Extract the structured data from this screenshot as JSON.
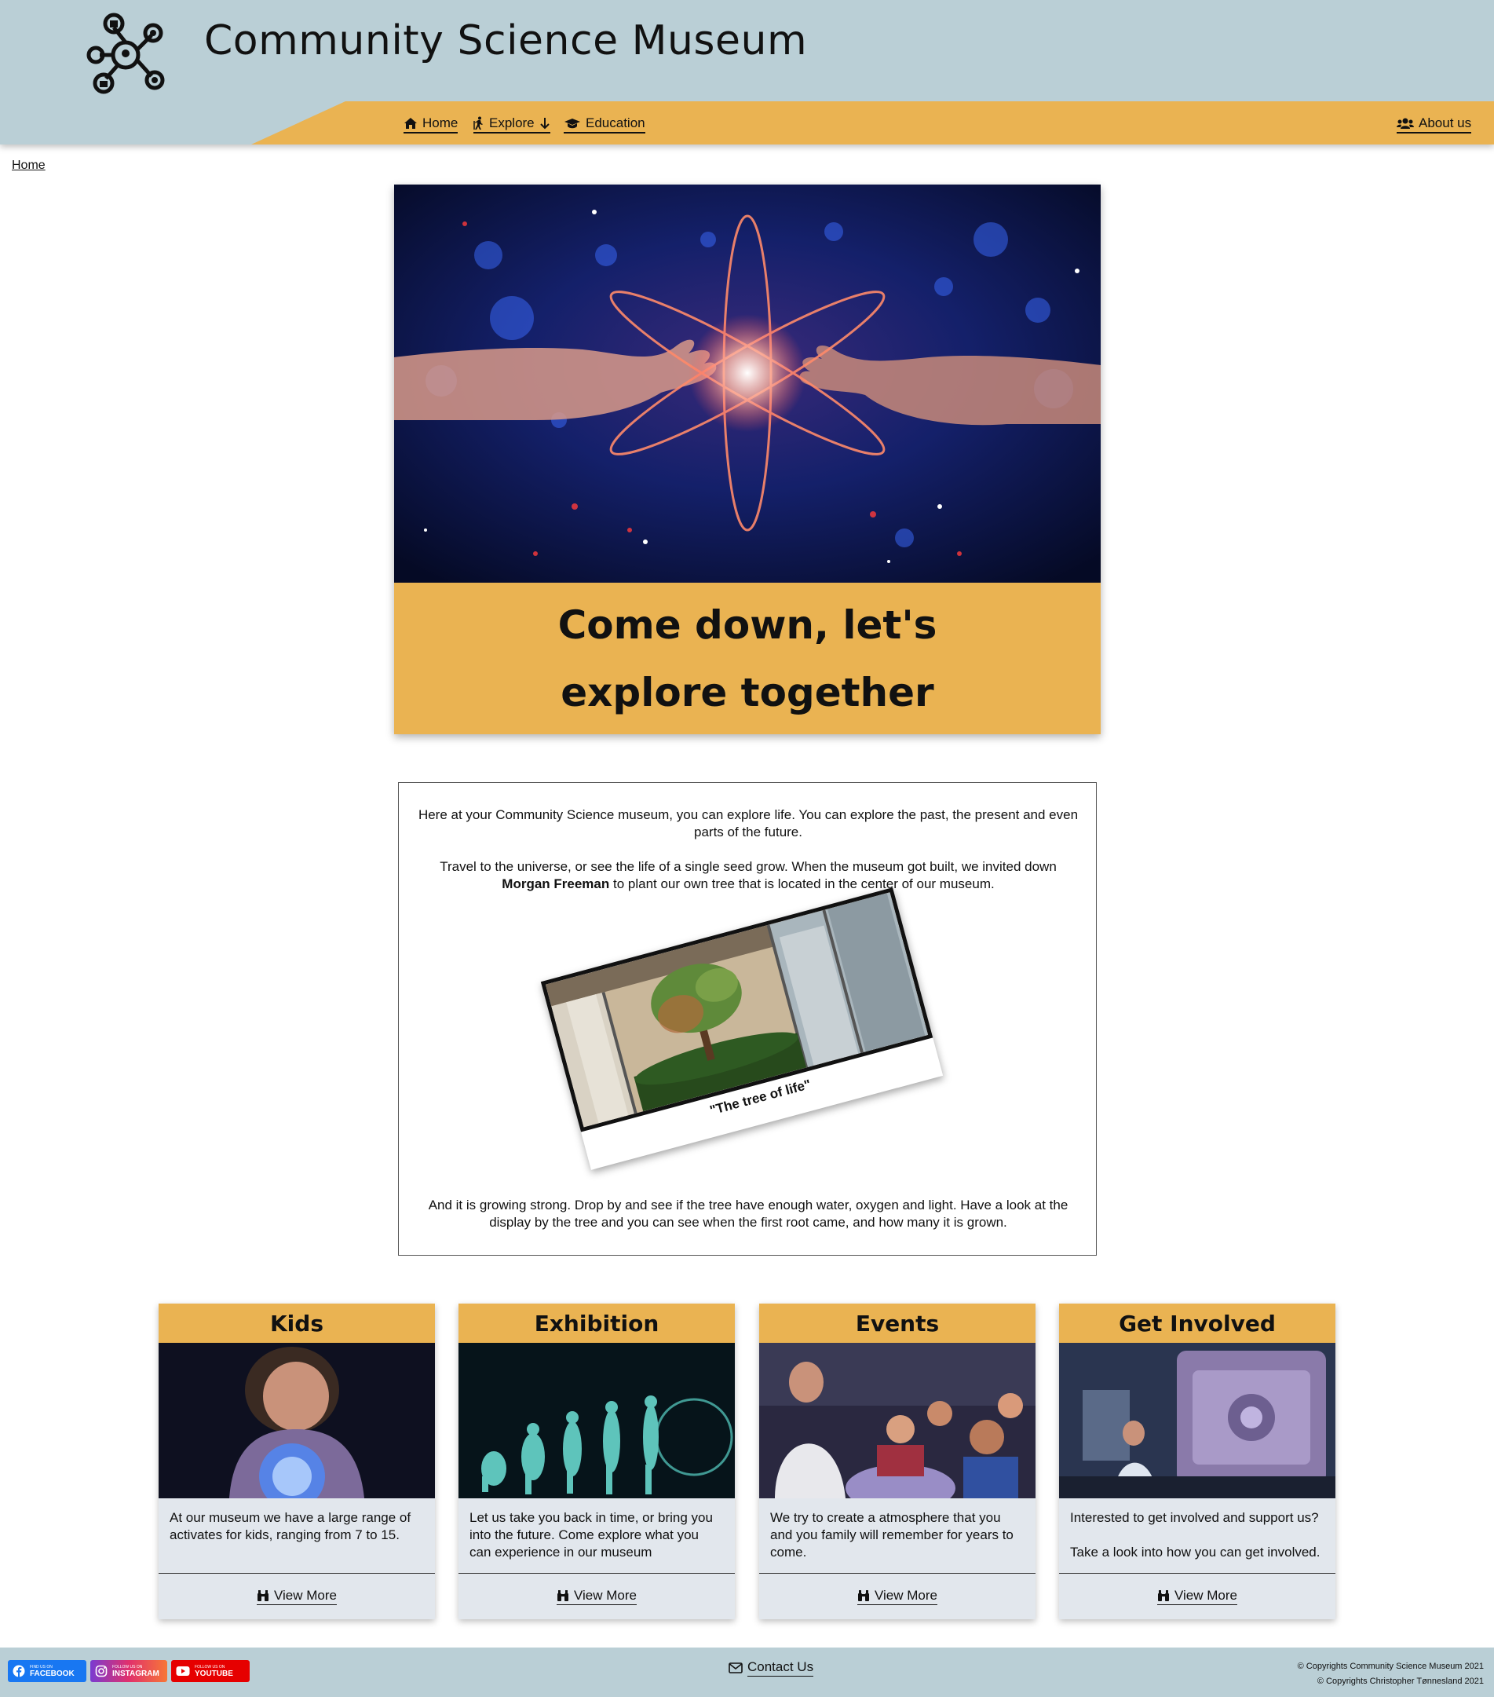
{
  "header": {
    "title": "Community Science Museum",
    "logo_icon": "molecule-network-logo",
    "colors": {
      "header_bg": "#bacfd6",
      "nav_accent": "#eab352"
    }
  },
  "nav": {
    "home": {
      "label": "Home",
      "icon": "home-icon"
    },
    "explore": {
      "label": "Explore",
      "icon": "hiking-icon",
      "dropdown_icon": "arrow-down-icon"
    },
    "education": {
      "label": "Education",
      "icon": "graduation-cap-icon"
    },
    "about": {
      "label": "About us",
      "icon": "users-icon"
    }
  },
  "breadcrumb": {
    "current": "Home"
  },
  "hero": {
    "image_subject": "hands reaching toward glowing atom",
    "caption": "Come down, let's explore together"
  },
  "intro": {
    "p1": "Here at your Community Science museum, you can explore life. You can explore the past, the present and even parts of the future.",
    "p2_before": "Travel to the universe, or see the life of a single seed grow. When the museum got built, we invited down ",
    "p2_bold": "Morgan Freeman",
    "p2_after": " to plant our own tree that is located in the center of our museum.",
    "photo_caption": "\"The tree of life\"",
    "p3": "And it is growing strong. Drop by and see if the tree have enough water, oxygen and light. Have a look at the display by the tree and you can see when the first root came, and how many it is grown."
  },
  "cards": [
    {
      "title": "Kids",
      "text": "At our museum we have a large range of activates for kids, ranging from 7 to 15.",
      "link": "View More",
      "link_icon": "binoculars-icon"
    },
    {
      "title": "Exhibition",
      "text": "Let us take you back in time, or bring you into the future. Come explore what you can experience in our museum",
      "link": "View More",
      "link_icon": "binoculars-icon"
    },
    {
      "title": "Events",
      "text": "We try to create a atmosphere that you and you family will remember for years to come.",
      "link": "View More",
      "link_icon": "binoculars-icon"
    },
    {
      "title": "Get Involved",
      "text": "Interested to get involved and support us?\n\nTake a look into how you can get involved.",
      "link": "View More",
      "link_icon": "binoculars-icon"
    }
  ],
  "footer": {
    "social": {
      "facebook": {
        "small": "FIND US ON",
        "big": "FACEBOOK",
        "color": "#1877f2"
      },
      "instagram": {
        "small": "FOLLOW US ON",
        "big": "INSTAGRAM",
        "color": "#c13584"
      },
      "youtube": {
        "small": "FOLLOW US ON",
        "big": "YOUTUBE",
        "color": "#e60000"
      }
    },
    "contact": {
      "label": "Contact Us",
      "icon": "envelope-icon"
    },
    "copyright_1": "© Copyrights Community Science Museum 2021",
    "copyright_2": "© Copyrights Christopher Tønnesland 2021"
  }
}
